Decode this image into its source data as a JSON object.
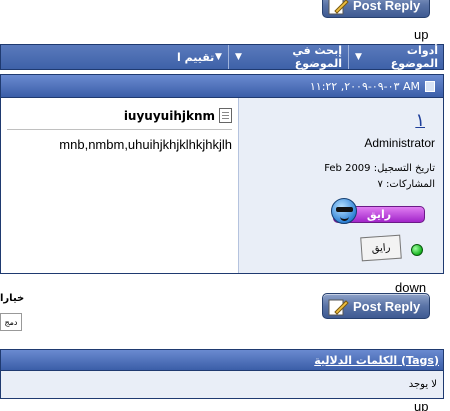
{
  "post_reply_label": "Post Reply",
  "nav_up": "up",
  "nav_down": "down",
  "toolbar": {
    "thread_tools": "أدوات الموضوع",
    "search_thread": "إبحث في الموضوع",
    "rate_thread": "تقييم ا"
  },
  "post": {
    "date": "٠٣-٠٩-٢٠٠٩, ١١:٢٢ AM",
    "title": "iuyuyuihjknm",
    "message": "mnb,nmbm,uhuihjkhjklhkjhkjlh",
    "user": {
      "name": "١",
      "role": "Administrator",
      "join_label": "تاريخ التسجيل:",
      "join_value": "Feb 2009",
      "posts_label": "المشاركات:",
      "posts_value": "٧",
      "mood": "رايق",
      "rep_label": "رايق"
    }
  },
  "options": {
    "label": "خيارا",
    "select_value": "دمج"
  },
  "tags": {
    "header": "الكلمات الدلالية (Tags)",
    "value": "لا يوجد"
  },
  "colors": {
    "accent": "#3e62a8",
    "panel": "#e9eef7",
    "mood": "#c04be0",
    "online": "#15b31f"
  }
}
